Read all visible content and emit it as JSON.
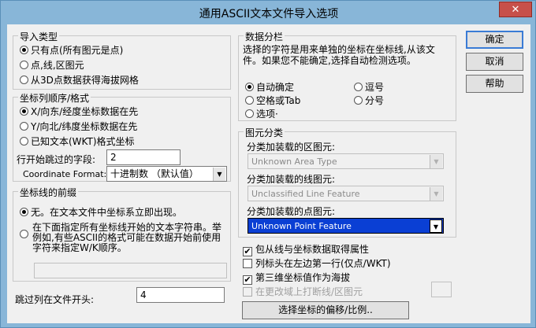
{
  "window": {
    "title": "通用ASCII文本文件导入选项",
    "close_label": "✕"
  },
  "import_type": {
    "legend": "导入类型",
    "options": [
      "只有点(所有图元是点)",
      "点,线,区图元",
      "从3D点数据获得海拔网格"
    ],
    "selected": 0
  },
  "coord_order": {
    "legend": "坐标列顺序/格式",
    "options": [
      "X/向东/经度坐标数据在先",
      "Y/向北/纬度坐标数据在先",
      "已知文本(WKT)格式坐标"
    ],
    "selected": 0,
    "skip_fields_label": "行开始跳过的字段:",
    "skip_fields_value": "2",
    "format_label": "Coordinate Format:",
    "format_value": "十进制数 （默认值）"
  },
  "prefix": {
    "legend": "坐标线的前缀",
    "option1": "无。在文本文件中坐标系立即出现。",
    "option2_line1": "在下面指定所有坐标线开始的文本字符串。举",
    "option2_line2": "例如,有些ASCII的格式可能在数据开始前使用",
    "option2_line3": "字符来指定W/K顺序。",
    "selected": 0,
    "text_value": ""
  },
  "skip_to_header": {
    "label": "跳过列在文件开头:",
    "value": "4"
  },
  "delimiter": {
    "legend": "数据分栏",
    "desc_line1": "选择的字符是用来单独的坐标在坐标线,从该文",
    "desc_line2": "件。如果您不能确定,选择自动检测选项。",
    "options": [
      "自动确定",
      "空格或Tab",
      "选项·",
      "逗号",
      "分号"
    ],
    "selected": 0
  },
  "feature_class": {
    "legend": "图元分类",
    "area_label": "分类加装载的区图元:",
    "area_value": "Unknown Area Type",
    "line_label": "分类加装载的线图元:",
    "line_value": "Unclassified Line Feature",
    "point_label": "分类加装载的点图元:",
    "point_value": "Unknown Point Feature"
  },
  "checks": [
    {
      "label": "包从线与坐标数据取得属性",
      "checked": true,
      "disabled": false
    },
    {
      "label": "列标头在左边第一行(仅点/WKT)",
      "checked": false,
      "disabled": false
    },
    {
      "label": "第三维坐标值作为海拔",
      "checked": true,
      "disabled": false
    },
    {
      "label": "在更改域上打断线/区图元",
      "checked": false,
      "disabled": true
    }
  ],
  "side_value": "",
  "buttons": {
    "ok": "确定",
    "cancel": "取消",
    "help": "帮助",
    "projection": "选择坐标的偏移/比例.."
  }
}
